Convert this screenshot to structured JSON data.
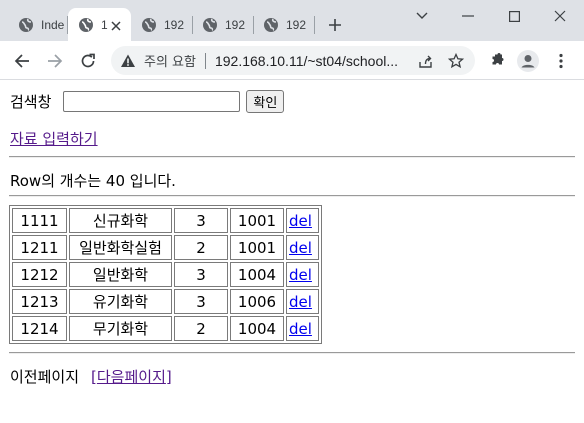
{
  "browser": {
    "tabs": [
      {
        "title": "Inde"
      },
      {
        "title": "1"
      },
      {
        "title": "192"
      },
      {
        "title": "192"
      },
      {
        "title": "192"
      }
    ],
    "security_label": "주의 요함",
    "url": "192.168.10.11/~st04/school..."
  },
  "page": {
    "search_label": "검색창",
    "search_value": "",
    "search_button": "확인",
    "input_link": "자료 입력하기",
    "row_count_text": "Row의 개수는 40 입니다.",
    "rows": [
      {
        "id": "1111",
        "name": "신규화학",
        "credit": "3",
        "code": "1001",
        "del": "del"
      },
      {
        "id": "1211",
        "name": "일반화학실험",
        "credit": "2",
        "code": "1001",
        "del": "del"
      },
      {
        "id": "1212",
        "name": "일반화학",
        "credit": "3",
        "code": "1004",
        "del": "del"
      },
      {
        "id": "1213",
        "name": "유기화학",
        "credit": "3",
        "code": "1006",
        "del": "del"
      },
      {
        "id": "1214",
        "name": "무기화학",
        "credit": "2",
        "code": "1004",
        "del": "del"
      }
    ],
    "prev_page": "이전페이지",
    "next_open": "[",
    "next_page": "다음페이지",
    "next_close": "]"
  }
}
